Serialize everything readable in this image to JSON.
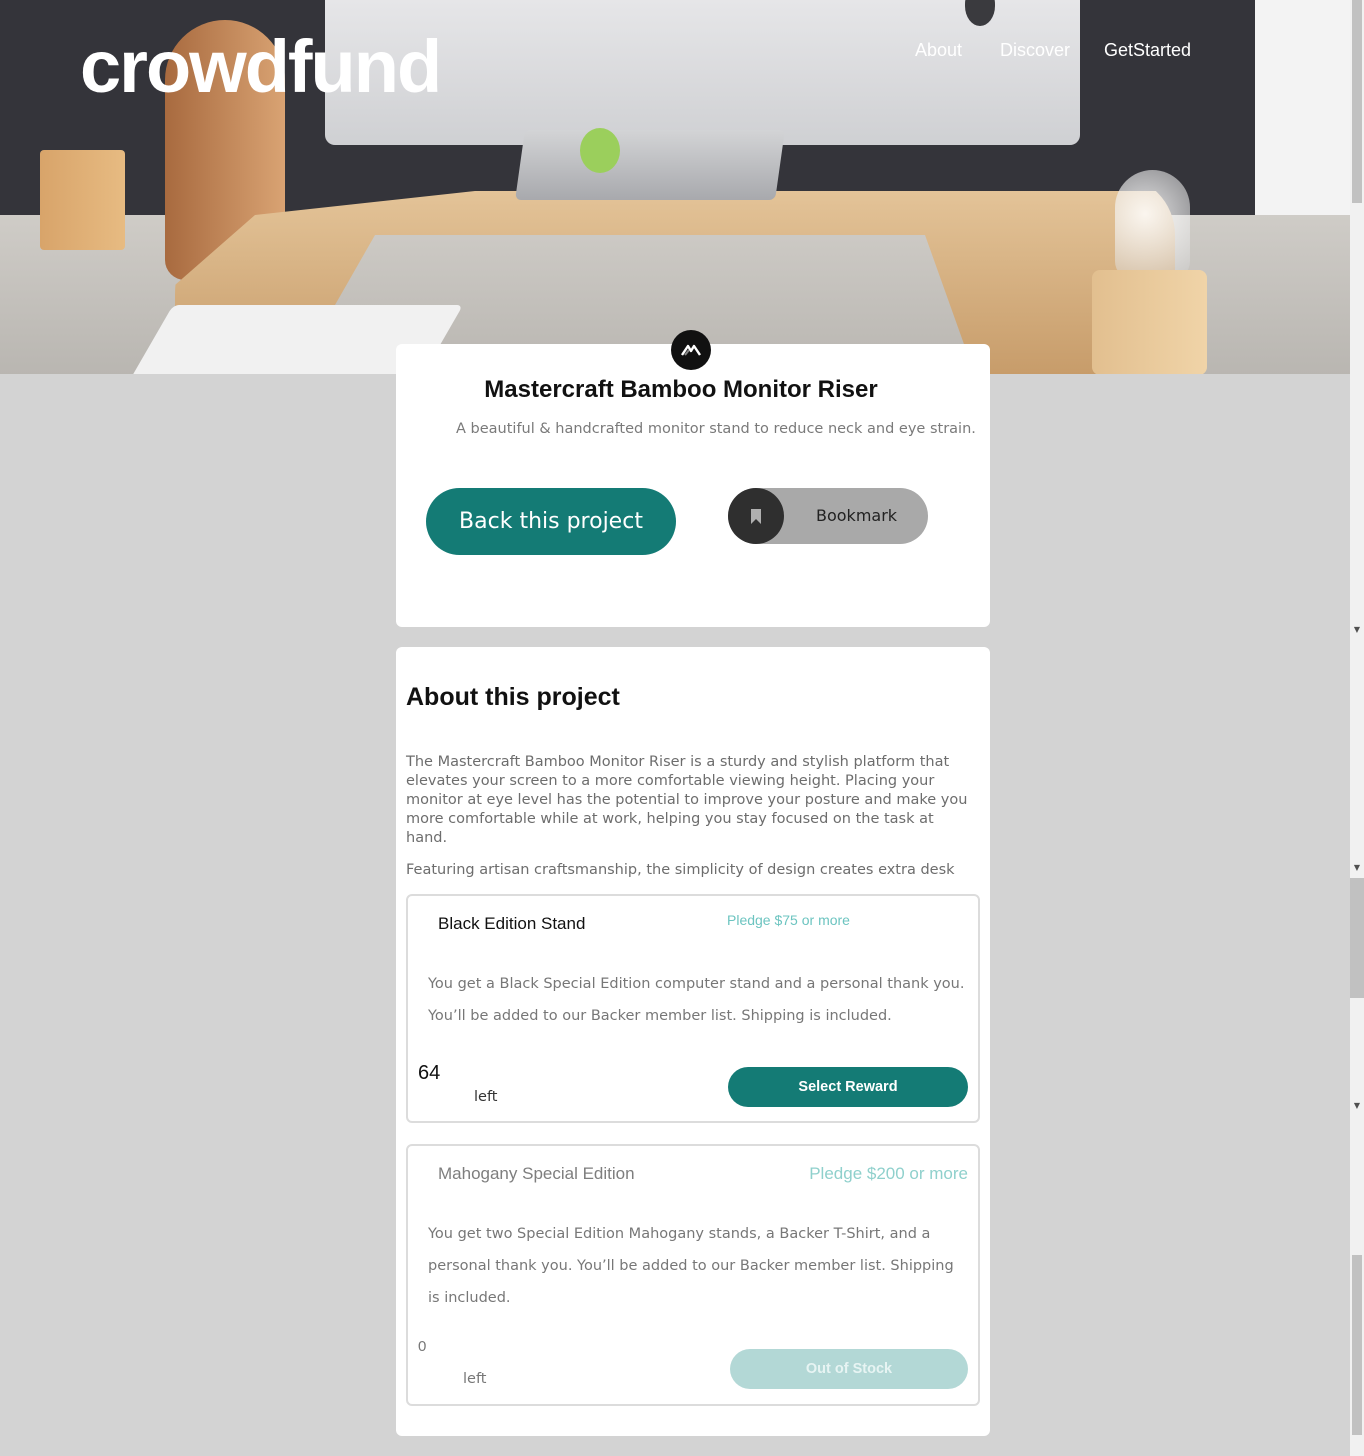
{
  "header": {
    "logo": "crowdfund",
    "nav": [
      "About",
      "Discover",
      "GetStarted"
    ]
  },
  "project": {
    "title": "Mastercraft Bamboo Monitor Riser",
    "subtitle": "A beautiful & handcrafted monitor stand to reduce neck and eye strain.",
    "back_label": "Back this project",
    "bookmark_label": "Bookmark",
    "logo_icon": "mastercraft-logo-icon",
    "bookmark_icon": "bookmark-icon"
  },
  "about": {
    "heading": "About this project",
    "paragraph_1": "The Mastercraft Bamboo Monitor Riser is a sturdy and stylish platform that elevates your screen to a more comfortable viewing height. Placing your monitor at eye level has the potential to improve your posture and make you more comfortable while at work, helping you stay focused on the task at hand.",
    "paragraph_2": "Featuring artisan craftsmanship, the simplicity of design creates extra desk"
  },
  "rewards": [
    {
      "name": "Black Edition Stand",
      "pledge": "Pledge $75 or more",
      "description": "You get a Black Special Edition computer stand and a personal thank you. You’ll be added to our Backer member list. Shipping is included.",
      "left_count": "64",
      "left_label": "left",
      "button": "Select Reward"
    },
    {
      "name": "Mahogany Special Edition",
      "pledge": "Pledge $200 or more",
      "description": "You get two Special Edition Mahogany stands, a Backer T-Shirt, and a personal thank you. You’ll be added to our Backer member list. Shipping is included.",
      "left_count": "0",
      "left_label": "left",
      "button": "Out of Stock"
    }
  ],
  "colors": {
    "accent": "#147b75",
    "accent_light": "#6cc4c0",
    "page_bg": "#d3d3d3",
    "out_of_stock": "#b3d8d6"
  }
}
